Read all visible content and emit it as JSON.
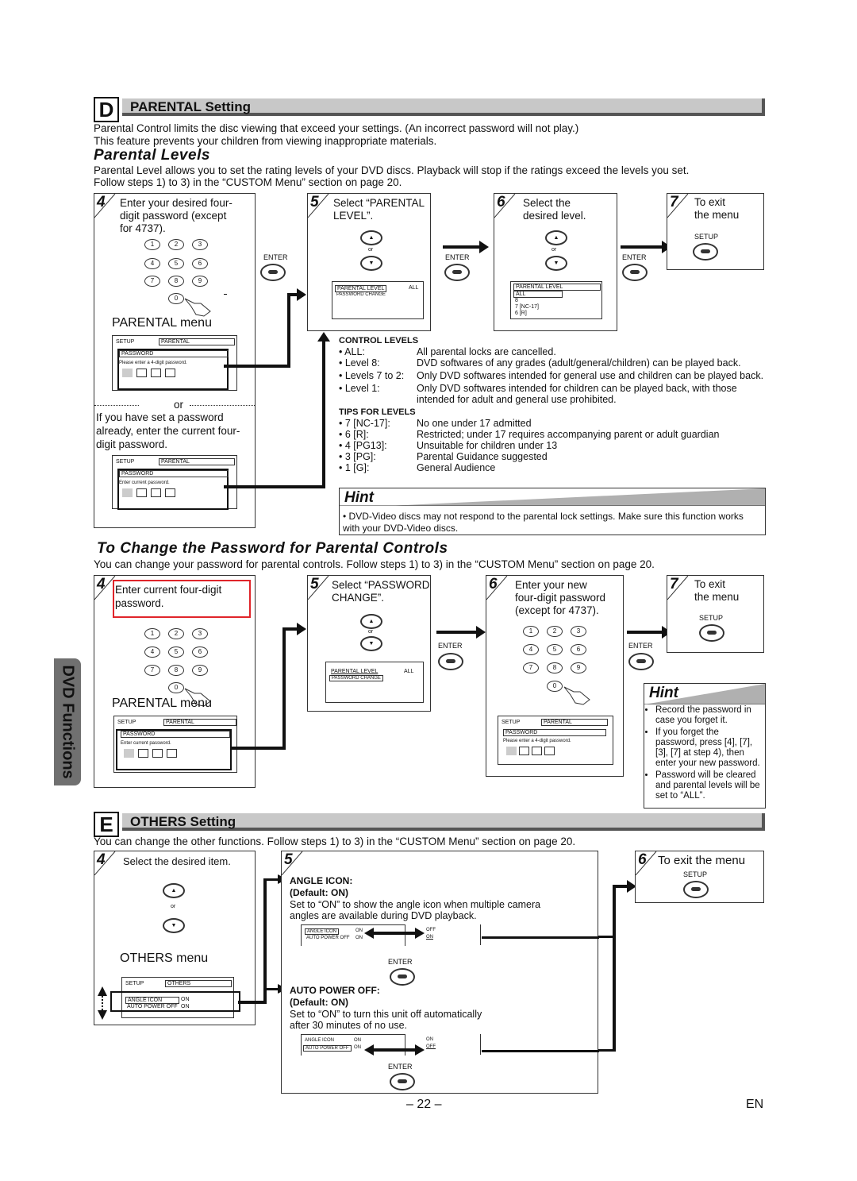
{
  "side_tab": "DVD Functions",
  "section_d": {
    "letter": "D",
    "title": "PARENTAL Setting",
    "intro_1": "Parental Control limits the disc viewing that exceed your settings. (An incorrect password will not play.)",
    "intro_2": "This feature prevents your children from viewing inappropriate materials.",
    "levels_heading": "Parental Levels",
    "levels_text_1": "Parental Level allows you to set the rating levels of your DVD discs. Playback will stop if the ratings exceed the levels you set.",
    "levels_text_2": "Follow steps 1) to 3) in the “CUSTOM Menu” section on page 20.",
    "step4": {
      "num": "4",
      "text_1": "Enter your desired four-",
      "text_2": "digit password (except",
      "text_3": "for 4737).",
      "menu_title": "PARENTAL menu",
      "or": "or",
      "alt_1": "If you have set a password",
      "alt_2": "already, enter the current four-",
      "alt_3": "digit password.",
      "screen1": {
        "setup": "SETUP",
        "tab": "PARENTAL",
        "field": "PASSWORD",
        "prompt": "Please enter a 4-digit password."
      },
      "screen2": {
        "setup": "SETUP",
        "tab": "PARENTAL",
        "field": "PASSWORD",
        "prompt": "Enter current password."
      }
    },
    "step5": {
      "num": "5",
      "text_1": "Select “PARENTAL",
      "text_2": "LEVEL”.",
      "or": "or",
      "row1": "PARENTAL LEVEL",
      "row1_val": "ALL",
      "row2": "PASSWORD CHANGE"
    },
    "step6": {
      "num": "6",
      "text_1": "Select the",
      "text_2": "desired level.",
      "or": "or",
      "header": "PARENTAL LEVEL",
      "options": [
        "ALL",
        "8",
        "7 [NC-17]",
        "6 [R]"
      ]
    },
    "step7": {
      "num": "7",
      "text_1": "To exit",
      "text_2": "the menu",
      "setup": "SETUP"
    },
    "enter_label": "ENTER",
    "control_levels": {
      "title": "CONTROL LEVELS",
      "rows": [
        {
          "k": "• ALL:",
          "v": "All parental locks are cancelled."
        },
        {
          "k": "• Level 8:",
          "v": "DVD softwares of any grades (adult/general/children) can be played back."
        },
        {
          "k": "• Levels 7 to 2:",
          "v": "Only DVD softwares intended for general use and children can be played back."
        },
        {
          "k": "• Level 1:",
          "v": "Only DVD softwares intended for children can be played back, with those intended for adult and general use prohibited."
        }
      ]
    },
    "tips_levels": {
      "title": "TIPS FOR LEVELS",
      "rows": [
        {
          "k": "• 7 [NC-17]:",
          "v": "No one under 17 admitted"
        },
        {
          "k": "• 6 [R]:",
          "v": "Restricted; under 17 requires accompanying parent or adult guardian"
        },
        {
          "k": "• 4 [PG13]:",
          "v": "Unsuitable for children under 13"
        },
        {
          "k": "• 3 [PG]:",
          "v": "Parental Guidance suggested"
        },
        {
          "k": "• 1 [G]:",
          "v": "General Audience"
        }
      ]
    },
    "hint": {
      "title": "Hint",
      "text": "• DVD-Video discs may not respond to the parental lock settings. Make sure this function works with your DVD-Video discs."
    }
  },
  "change_password": {
    "heading": "To Change the Password for Parental Controls",
    "text": "You can change your password for parental controls.  Follow steps 1) to 3) in the “CUSTOM Menu” section on page 20.",
    "step4": {
      "num": "4",
      "text_1": "Enter current four-digit",
      "text_2": "password.",
      "menu_title": "PARENTAL menu",
      "screen": {
        "setup": "SETUP",
        "tab": "PARENTAL",
        "field": "PASSWORD",
        "prompt": "Enter current password."
      }
    },
    "step5": {
      "num": "5",
      "text_1": "Select “PASSWORD",
      "text_2": "CHANGE”.",
      "or": "or",
      "row1": "PARENTAL LEVEL",
      "row1_val": "ALL",
      "row2": "PASSWORD CHANGE"
    },
    "step6": {
      "num": "6",
      "text_1": "Enter your new",
      "text_2": "four-digit password",
      "text_3": "(except for 4737).",
      "screen": {
        "setup": "SETUP",
        "tab": "PARENTAL",
        "field": "PASSWORD",
        "prompt": "Please enter a 4-digit password."
      }
    },
    "step7": {
      "num": "7",
      "text_1": "To exit",
      "text_2": "the menu",
      "setup": "SETUP"
    },
    "hint": {
      "title": "Hint",
      "items": [
        "Record the password in case you forget it.",
        "If you forget the password, press [4], [7], [3], [7] at step 4), then enter your new password.",
        "Password will be cleared and parental levels will be set to “ALL”."
      ]
    }
  },
  "keypad": [
    "1",
    "2",
    "3",
    "4",
    "5",
    "6",
    "7",
    "8",
    "9",
    "0"
  ],
  "section_e": {
    "letter": "E",
    "title": "OTHERS Setting",
    "intro": "You can change the other functions. Follow steps 1) to 3) in the “CUSTOM Menu” section on page 20.",
    "step4": {
      "num": "4",
      "text": "Select the desired item.",
      "or": "or",
      "menu_title": "OTHERS menu",
      "screen": {
        "setup": "SETUP",
        "tab": "OTHERS",
        "row1": "ANGLE ICON",
        "row1_val": "ON",
        "row2": "AUTO POWER OFF",
        "row2_val": "ON"
      }
    },
    "step5": {
      "num": "5",
      "angle": {
        "title": "ANGLE ICON:",
        "default": "(Default: ON)",
        "text_1": "Set to “ON” to show the angle icon when multiple camera",
        "text_2": "angles are available during DVD playback.",
        "row1": "ANGLE ICON",
        "row1_val": "ON",
        "row2": "AUTO POWER OFF",
        "row2_val": "ON",
        "opt1": "OFF",
        "opt2": "ON"
      },
      "auto": {
        "title": "AUTO POWER OFF:",
        "default": "(Default: ON)",
        "text_1": "Set to “ON” to turn this unit off automatically",
        "text_2": "after 30 minutes of no use.",
        "row1": "ANGLE ICON",
        "row1_val": "ON",
        "row2": "AUTO POWER OFF",
        "row2_val": "ON",
        "opt1": "ON",
        "opt2": "OFF"
      },
      "enter": "ENTER"
    },
    "step6": {
      "num": "6",
      "text": "To exit the menu",
      "setup": "SETUP"
    }
  },
  "footer": {
    "page": "– 22 –",
    "lang": "EN"
  },
  "colors": {
    "highlight_red": "#e0242a",
    "bar_gray": "#c8c8c8",
    "tab_gray": "#707070"
  }
}
